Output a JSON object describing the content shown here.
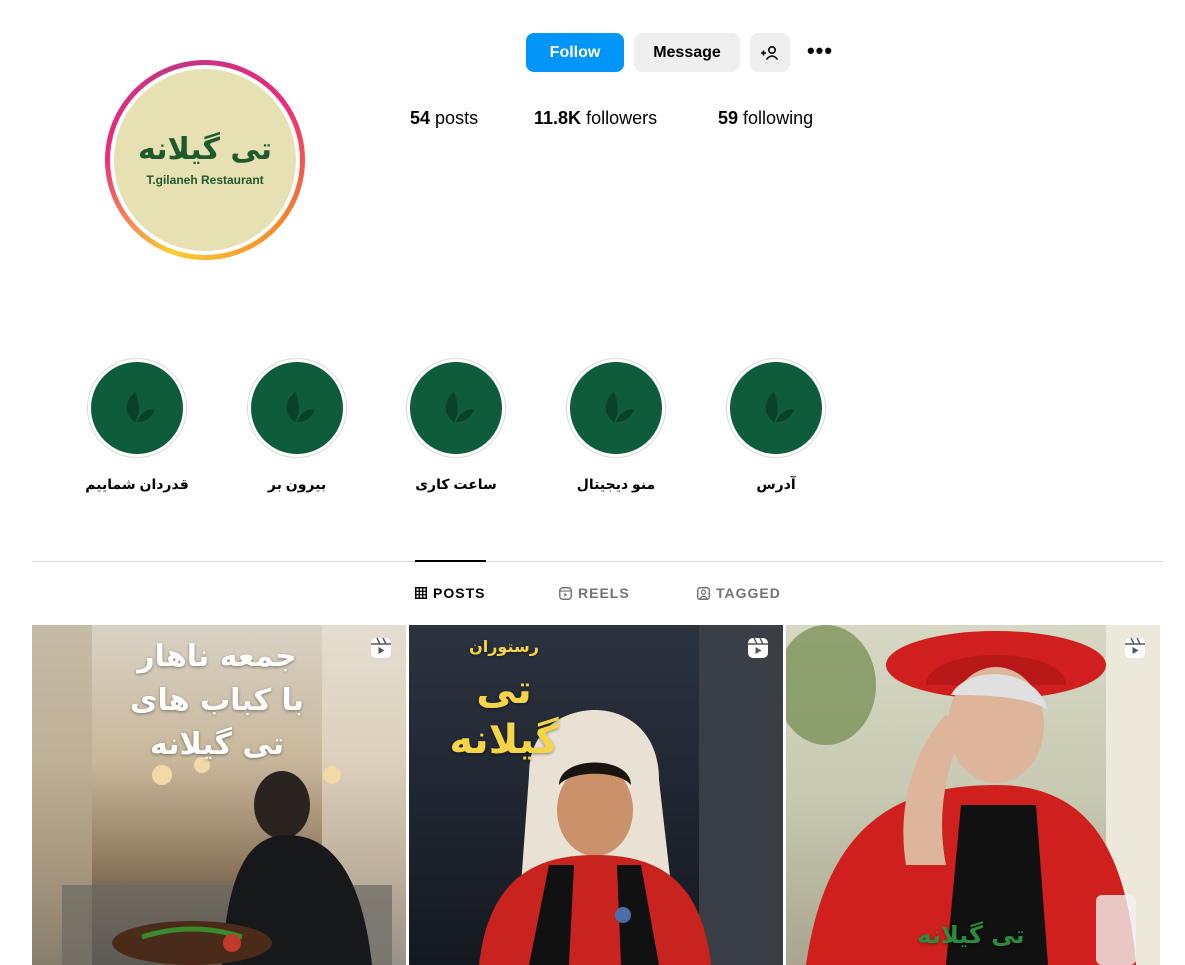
{
  "profile": {
    "logo_text_fa": "تی گیلانه",
    "logo_text_en": "T.gilaneh Restaurant"
  },
  "actions": {
    "follow": "Follow",
    "message": "Message",
    "suggest_icon": "add-person-icon",
    "more": "•••"
  },
  "stats": {
    "posts_count": "54",
    "posts_label": "posts",
    "followers_count": "11.8K",
    "followers_label": "followers",
    "following_count": "59",
    "following_label": "following"
  },
  "highlights": [
    {
      "label": "قدردان شماییم",
      "icon": "leaf-icon"
    },
    {
      "label": "بیرون بر",
      "icon": "leaf-icon"
    },
    {
      "label": "ساعت کاری",
      "icon": "leaf-icon"
    },
    {
      "label": "منو دیجیتال",
      "icon": "leaf-icon"
    },
    {
      "label": "آدرس",
      "icon": "leaf-icon"
    }
  ],
  "tabs": {
    "posts": "POSTS",
    "reels": "REELS",
    "tagged": "TAGGED"
  },
  "posts": [
    {
      "type": "reel",
      "text_lines": [
        "جمعه ناهار",
        "با کباب های",
        "تی گیلانه"
      ]
    },
    {
      "type": "reel",
      "text_top": "رستوران",
      "text_main": "تی گیلانه"
    },
    {
      "type": "reel",
      "watermark": "تی گیلانه"
    }
  ],
  "colors": {
    "follow_blue": "#0095f6",
    "highlight_green": "#0e5c3c",
    "logo_green": "#1f5a2e",
    "logo_bg": "#e6e0b2"
  }
}
